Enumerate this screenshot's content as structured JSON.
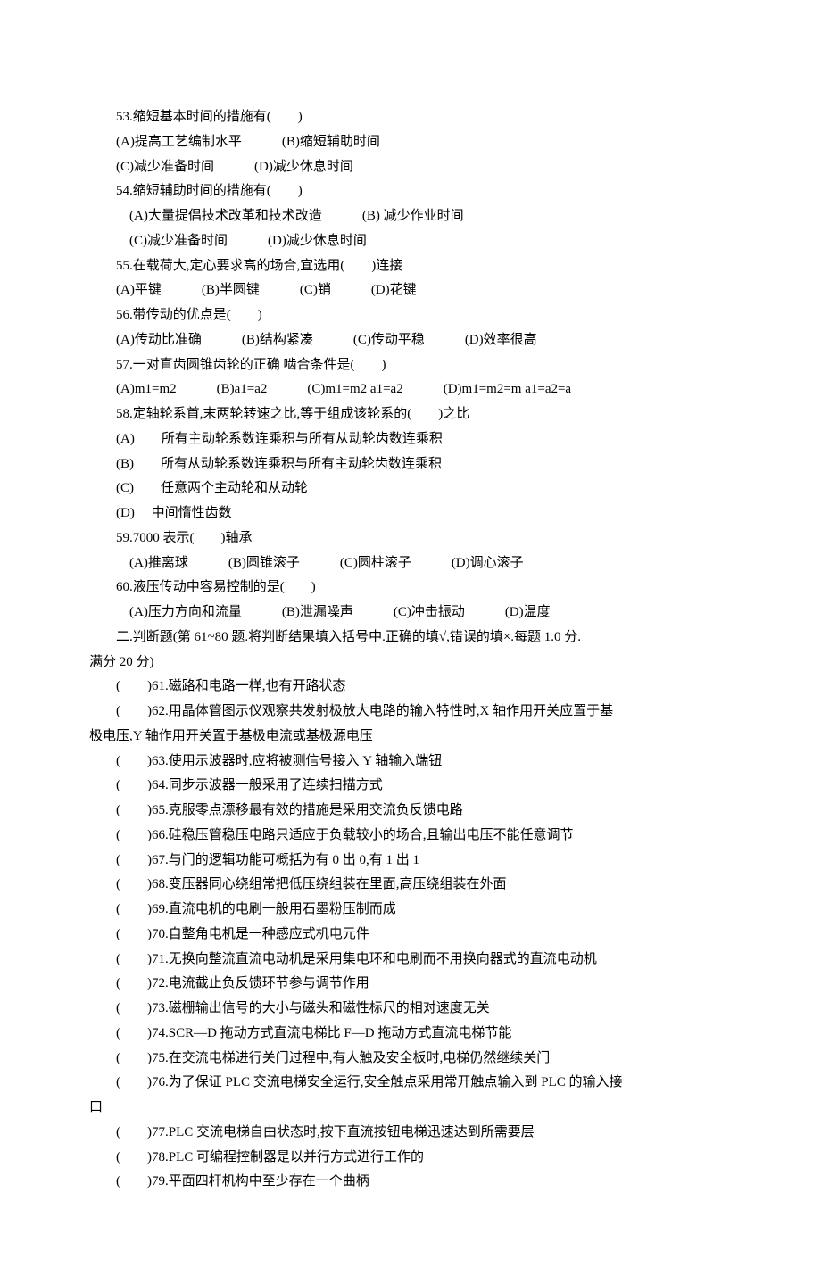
{
  "questions": {
    "q53": {
      "text": "53.缩短基本时间的措施有(　　)",
      "optA": "(A)提高工艺编制水平　　　(B)缩短辅助时间",
      "optB": "(C)减少准备时间　　　(D)减少休息时间"
    },
    "q54": {
      "text": "54.缩短辅助时间的措施有(　　)",
      "optA": "(A)大量提倡技术改革和技术改造　　　(B) 减少作业时间",
      "optB": "(C)减少准备时间　　　(D)减少休息时间"
    },
    "q55": {
      "text": "55.在载荷大,定心要求高的场合,宜选用(　　)连接",
      "opt": "(A)平键　　　(B)半圆键　　　(C)销　　　(D)花键"
    },
    "q56": {
      "text": "56.带传动的优点是(　　)",
      "opt": "(A)传动比准确　　　(B)结构紧凑　　　(C)传动平稳　　　(D)效率很高"
    },
    "q57": {
      "text": "57.一对直齿圆锥齿轮的正确 啮合条件是(　　)",
      "opt": "(A)m1=m2　　　(B)a1=a2　　　(C)m1=m2 a1=a2　　　(D)m1=m2=m a1=a2=a"
    },
    "q58": {
      "text": "58.定轴轮系首,末两轮转速之比,等于组成该轮系的(　　)之比",
      "optA": "(A)　　所有主动轮系数连乘积与所有从动轮齿数连乘积",
      "optB": "(B)　　所有从动轮系数连乘积与所有主动轮齿数连乘积",
      "optC": "(C)　　任意两个主动轮和从动轮",
      "optD": "(D)　 中间惰性齿数"
    },
    "q59": {
      "text": "59.7000 表示(　　)轴承",
      "opt": "(A)推离球　　　(B)圆锥滚子　　　(C)圆柱滚子　　　(D)调心滚子"
    },
    "q60": {
      "text": "60.液压传动中容易控制的是(　　)",
      "opt": "(A)压力方向和流量　　　(B)泄漏噪声　　　(C)冲击振动　　　(D)温度"
    }
  },
  "section2": {
    "header": "二.判断题(第 61~80 题.将判断结果填入括号中.正确的填√,错误的填×.每题 1.0 分.",
    "headerCont": "满分 20 分)"
  },
  "judge": {
    "j61": "(　　)61.磁路和电路一样,也有开路状态",
    "j62a": "(　　)62.用晶体管图示仪观察共发射极放大电路的输入特性时,X 轴作用开关应置于基",
    "j62b": "极电压,Y 轴作用开关置于基极电流或基极源电压",
    "j63": "(　　)63.使用示波器时,应将被测信号接入 Y 轴输入端钮",
    "j64": "(　　)64.同步示波器一般采用了连续扫描方式",
    "j65": "(　　)65.克服零点漂移最有效的措施是采用交流负反馈电路",
    "j66": "(　　)66.硅稳压管稳压电路只适应于负载较小的场合,且输出电压不能任意调节",
    "j67": "(　　)67.与门的逻辑功能可概括为有 0 出 0,有 1 出 1",
    "j68": "(　　)68.变压器同心绕组常把低压绕组装在里面,高压绕组装在外面",
    "j69": "(　　)69.直流电机的电刷一般用石墨粉压制而成",
    "j70": "(　　)70.自整角电机是一种感应式机电元件",
    "j71": "(　　)71.无换向整流直流电动机是采用集电环和电刷而不用换向器式的直流电动机",
    "j72": "(　　)72.电流截止负反馈环节参与调节作用",
    "j73": "(　　)73.磁栅输出信号的大小与磁头和磁性标尺的相对速度无关",
    "j74": "(　　)74.SCR—D 拖动方式直流电梯比 F—D 拖动方式直流电梯节能",
    "j75": "(　　)75.在交流电梯进行关门过程中,有人触及安全板时,电梯仍然继续关门",
    "j76a": "(　　)76.为了保证 PLC 交流电梯安全运行,安全触点采用常开触点输入到 PLC 的输入接",
    "j76b": "口",
    "j77": "(　　)77.PLC 交流电梯自由状态时,按下直流按钮电梯迅速达到所需要层",
    "j78": "(　　)78.PLC 可编程控制器是以并行方式进行工作的",
    "j79": "(　　)79.平面四杆机构中至少存在一个曲柄"
  }
}
